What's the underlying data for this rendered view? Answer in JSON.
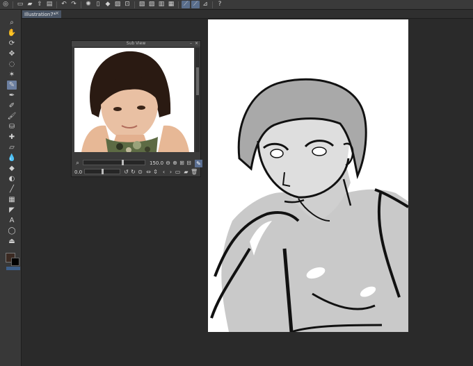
{
  "app": {
    "toolbar_icons": [
      "app-logo-icon",
      "new-file-icon",
      "open-file-icon",
      "save-icon",
      "undo-icon",
      "redo-icon",
      "loading-icon",
      "fill-icon",
      "stroke-icon",
      "transform-icon",
      "select-icon",
      "ruler-icon",
      "line-icon",
      "pen-icon",
      "help-icon"
    ]
  },
  "document": {
    "tab_label": "Illustration7*",
    "tab_close": "×"
  },
  "tools": [
    {
      "name": "zoom",
      "glyph": "⌕"
    },
    {
      "name": "hand",
      "glyph": "✋"
    },
    {
      "name": "rotate",
      "glyph": "⟳"
    },
    {
      "name": "move",
      "glyph": "✥"
    },
    {
      "name": "lasso",
      "glyph": "◌"
    },
    {
      "name": "magic-wand",
      "glyph": "✶"
    },
    {
      "name": "eyedropper",
      "glyph": "✎"
    },
    {
      "name": "pen",
      "glyph": "✒"
    },
    {
      "name": "pencil",
      "glyph": "✐"
    },
    {
      "name": "brush",
      "glyph": "🖌"
    },
    {
      "name": "airbrush",
      "glyph": "⛁"
    },
    {
      "name": "decoration",
      "glyph": "✚"
    },
    {
      "name": "eraser",
      "glyph": "▱"
    },
    {
      "name": "blend",
      "glyph": "💧"
    },
    {
      "name": "fill",
      "glyph": "◆"
    },
    {
      "name": "gradient",
      "glyph": "◐"
    },
    {
      "name": "figure",
      "glyph": "╱"
    },
    {
      "name": "frame",
      "glyph": "▦"
    },
    {
      "name": "ruler",
      "glyph": "◤"
    },
    {
      "name": "text",
      "glyph": "A"
    },
    {
      "name": "balloon",
      "glyph": "◯"
    },
    {
      "name": "correct-line",
      "glyph": "⏏"
    }
  ],
  "subview": {
    "title": "Sub View",
    "zoom_value": "150.0",
    "rotation_value": "0.0"
  },
  "colors": {
    "main": "#3b2a22",
    "sub": "#000000",
    "accent": "#5b6f92"
  }
}
